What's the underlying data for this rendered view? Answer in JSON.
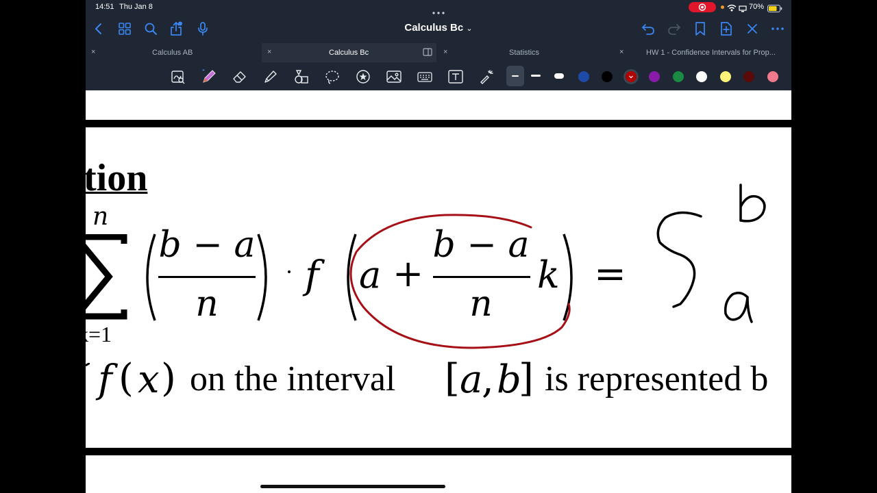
{
  "status_bar": {
    "time": "14:51",
    "date": "Thu Jan 8",
    "battery": "70%"
  },
  "nav": {
    "doc_title": "Calculus Bc",
    "title_chevron": "⌄"
  },
  "tabs": [
    {
      "label": "Calculus AB"
    },
    {
      "label": "Calculus Bc"
    },
    {
      "label": "Statistics"
    },
    {
      "label": "HW 1 - Confidence Intervals for Prop..."
    }
  ],
  "tab_close_glyph": "×",
  "pen_colors": [
    "#1e4aa8",
    "#000000",
    "#b00000",
    "#8a1aa8",
    "#1a8a45",
    "#ffffff",
    "#fff27a",
    "#5a0a0a",
    "#f07a8c"
  ],
  "annotation_color": "#a50f15",
  "page": {
    "heading_fragment": "tion",
    "sum_upper": "n",
    "sum_lower": "k=1",
    "frac_num": "b − a",
    "frac_den": "n",
    "f": "f",
    "a": "a",
    "plus": "+",
    "k": "k",
    "equals": "=",
    "dot": "·",
    "line2_f": "f",
    "line2_x": "x",
    "line2_text1": "on the interval",
    "line2_a": "a",
    "line2_b": "b",
    "line2_text2": "is represented b",
    "hand_upper": "b",
    "hand_lower": "a"
  }
}
